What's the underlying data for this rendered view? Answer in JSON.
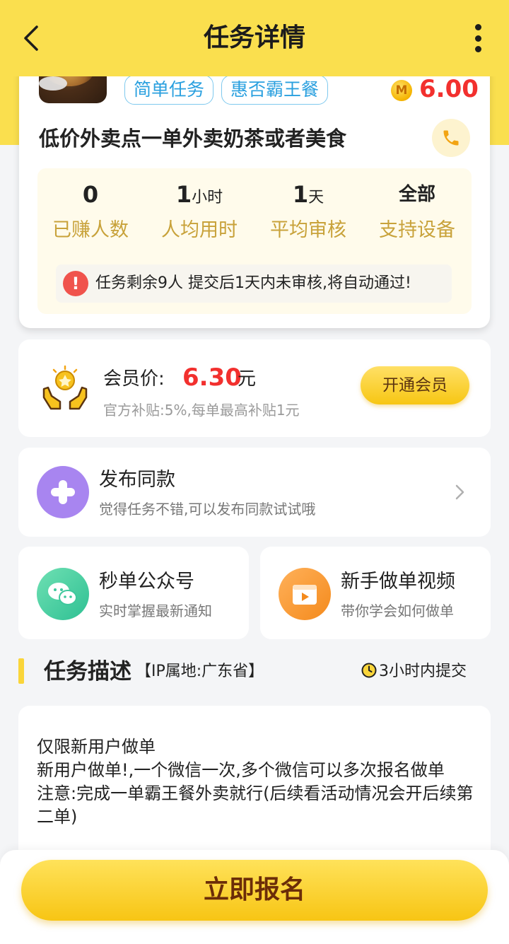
{
  "header": {
    "title": "任务详情"
  },
  "task": {
    "tags": [
      "简单任务",
      "惠否霸王餐"
    ],
    "coin_symbol": "M",
    "price": "6.00",
    "title": "低价外卖点一单外卖奶茶或者美食",
    "stats": [
      {
        "value": "0",
        "unit": "",
        "label": "已赚人数"
      },
      {
        "value": "1",
        "unit": "小时",
        "label": "人均用时"
      },
      {
        "value": "1",
        "unit": "天",
        "label": "平均审核"
      },
      {
        "value": "全部",
        "unit": "",
        "label": "支持设备"
      }
    ],
    "notice": "任务剩余9人  提交后1天内未审核,将自动通过!"
  },
  "member": {
    "label": "会员价:",
    "price": "6.30",
    "unit": "元",
    "subsidy": "官方补贴:5%,每单最高补贴1元",
    "button": "开通会员"
  },
  "publish": {
    "title": "发布同款",
    "subtitle": "觉得任务不错,可以发布同款试试哦"
  },
  "shortcuts": [
    {
      "title": "秒单公众号",
      "subtitle": "实时掌握最新通知",
      "icon": "wechat-icon"
    },
    {
      "title": "新手做单视频",
      "subtitle": "带你学会如何做单",
      "icon": "video-icon"
    }
  ],
  "description": {
    "title": "任务描述",
    "ip": "【IP属地:广东省】",
    "deadline": "3小时内提交",
    "lines": [
      "仅限新用户做单",
      "新用户做单!,一个微信一次,多个微信可以多次报名做单",
      "注意:完成一单霸王餐外卖就行(后续看活动情况会开后续第二单)"
    ]
  },
  "cta": {
    "label": "立即报名"
  },
  "colors": {
    "brand_yellow": "#fadf4e",
    "price_red": "#f2302e",
    "tag_blue": "#2aa0df",
    "stat_gold": "#c8a23a"
  }
}
